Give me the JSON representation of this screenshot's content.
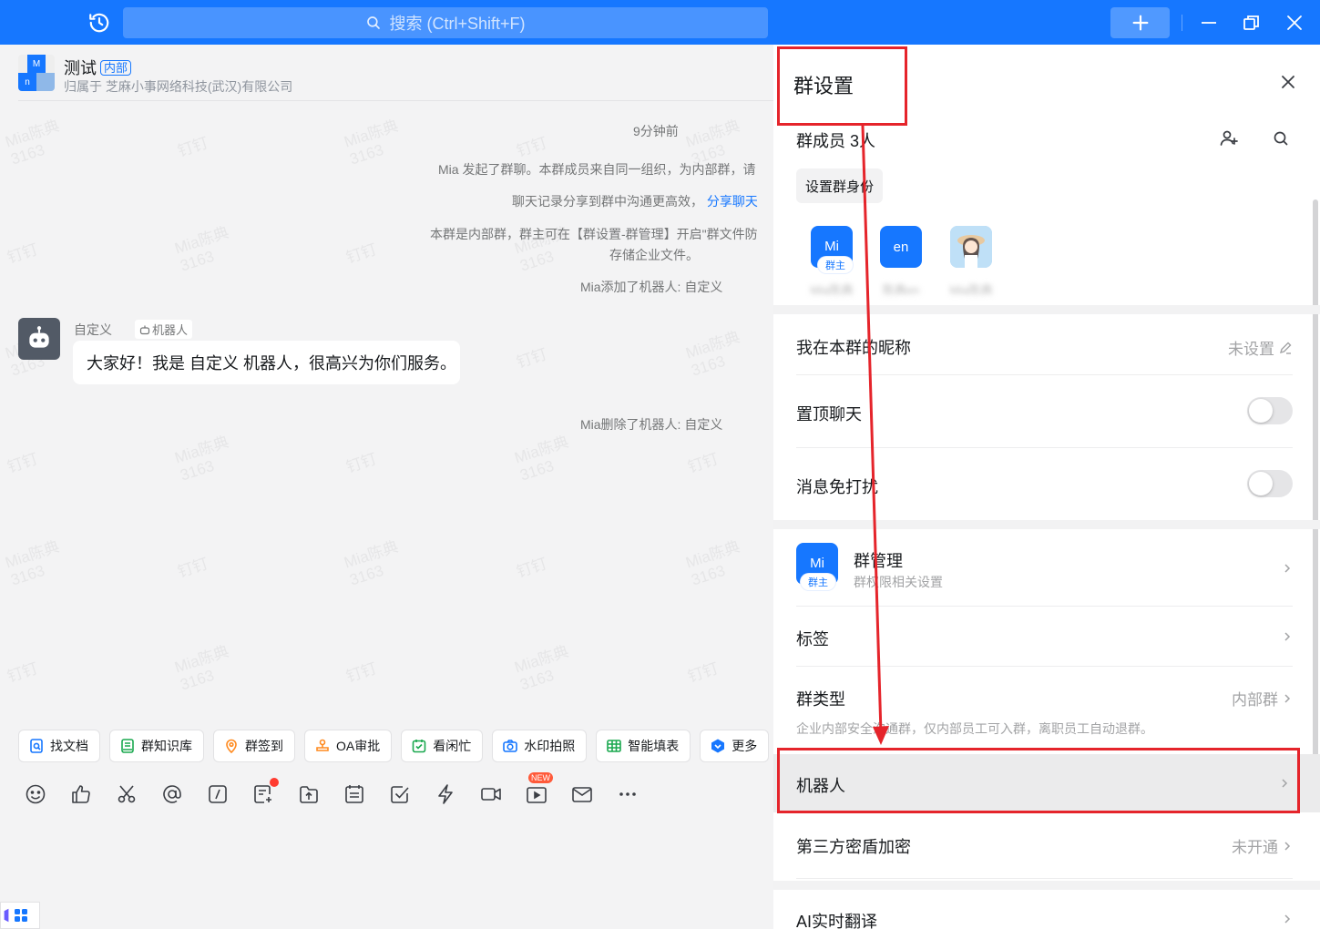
{
  "topbar": {
    "search_placeholder": "搜索 (Ctrl+Shift+F)",
    "accent": "#1677ff"
  },
  "chat": {
    "title": "测试",
    "badge": "内部",
    "subtitle": "归属于 芝麻小事网络科技(武汉)有限公司",
    "avatar_cells": [
      "M",
      "n"
    ],
    "time": "9分钟前",
    "sys1": "Mia 发起了群聊。本群成员来自同一组织，为内部群，请",
    "sys2_text": "聊天记录分享到群中沟通更高效，",
    "sys2_link": "分享聊天",
    "sys3_line1": "本群是内部群，群主可在【群设置-群管理】开启\"群文件防",
    "sys3_line2": "存储企业文件。",
    "sys4": "Mia添加了机器人: 自定义",
    "bot_name": "自定义",
    "bot_tag": "机器人",
    "bot_message": "大家好！我是 自定义 机器人，很高兴为你们服务。",
    "sys5": "Mia删除了机器人: 自定义",
    "watermark_name": "Mia陈典",
    "watermark_num": "3163",
    "watermark_app": "钉钉",
    "quick_actions": [
      {
        "label": "找文档",
        "icon": "doc-search-icon",
        "color": "#1677ff"
      },
      {
        "label": "群知识库",
        "icon": "knowledge-icon",
        "color": "#1aa84f"
      },
      {
        "label": "群签到",
        "icon": "checkin-icon",
        "color": "#ff8a1f"
      },
      {
        "label": "OA审批",
        "icon": "approval-icon",
        "color": "#ff8a1f"
      },
      {
        "label": "看闲忙",
        "icon": "calendar-check-icon",
        "color": "#1aa84f"
      },
      {
        "label": "水印拍照",
        "icon": "camera-icon",
        "color": "#1677ff"
      },
      {
        "label": "智能填表",
        "icon": "table-icon",
        "color": "#1aa84f"
      },
      {
        "label": "更多",
        "icon": "app-icon",
        "color": "#1677ff"
      }
    ],
    "tool_new": "NEW"
  },
  "panel": {
    "title": "群设置",
    "members_title": "群成员 3人",
    "set_role": "设置群身份",
    "members": [
      {
        "avatar": "Mi",
        "name": "Mia陈典",
        "owner": "群主"
      },
      {
        "avatar": "en",
        "name": "陈典en",
        "owner": ""
      },
      {
        "avatar": "",
        "name": "Mia陈典",
        "owner": ""
      }
    ],
    "nickname_label": "我在本群的昵称",
    "nickname_value": "未设置",
    "pin_label": "置顶聊天",
    "mute_label": "消息免打扰",
    "manage_avatar": "Mi",
    "manage_owner": "群主",
    "manage_label": "群管理",
    "manage_desc": "群权限相关设置",
    "tags_label": "标签",
    "type_label": "群类型",
    "type_value": "内部群",
    "type_desc": "企业内部安全沟通群，仅内部员工可入群，离职员工自动退群。",
    "robot_label": "机器人",
    "encrypt_label": "第三方密盾加密",
    "encrypt_value": "未开通",
    "ai_label": "AI实时翻译"
  },
  "colors": {
    "annotation": "#e5242b",
    "link": "#1677ff",
    "muted": "#a2a3a5"
  }
}
